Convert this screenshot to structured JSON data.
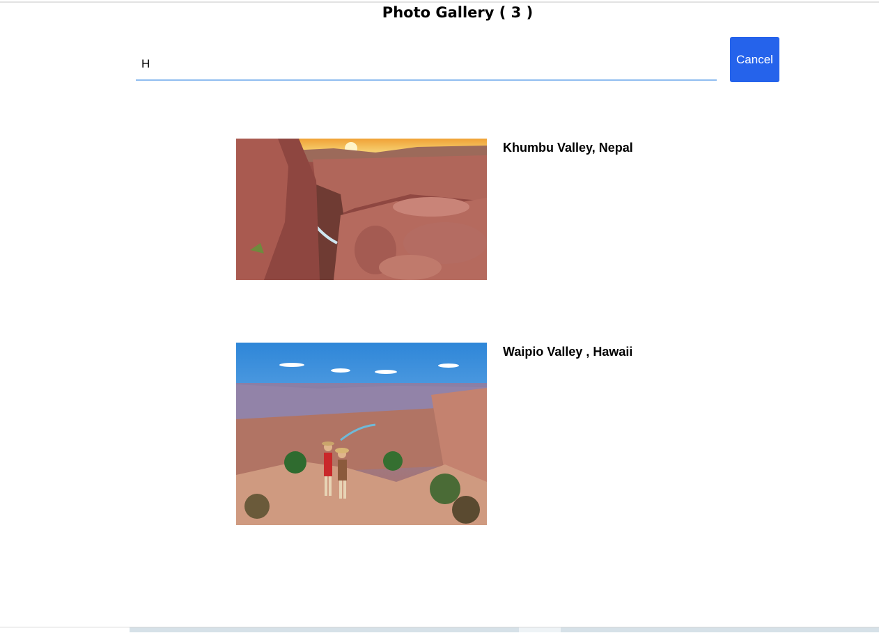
{
  "gallery": {
    "title": "Photo Gallery ( 3 )"
  },
  "search": {
    "value": "H",
    "placeholder": ""
  },
  "actions": {
    "cancel_label": "Cancel"
  },
  "photos": [
    {
      "label": "Khumbu Valley, Nepal"
    },
    {
      "label": "Waipio Valley , Hawaii"
    }
  ],
  "colors": {
    "accent": "#2563eb",
    "input_underline": "#90bdf0"
  }
}
